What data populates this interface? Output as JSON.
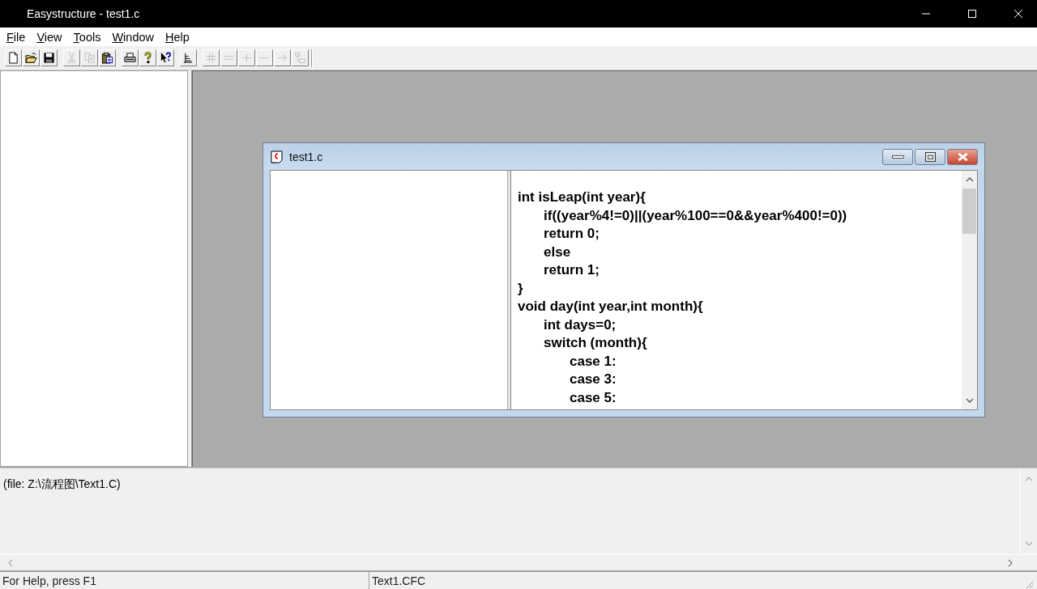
{
  "window": {
    "title": "Easystructure - test1.c"
  },
  "menu": [
    {
      "label": "File"
    },
    {
      "label": "View"
    },
    {
      "label": "Tools"
    },
    {
      "label": "Window"
    },
    {
      "label": "Help"
    }
  ],
  "toolbar": [
    {
      "buttons": [
        {
          "kind": "new",
          "disabled": false
        },
        {
          "kind": "open",
          "disabled": false
        },
        {
          "kind": "save",
          "disabled": false
        }
      ]
    },
    {
      "buttons": [
        {
          "kind": "cut",
          "disabled": true
        },
        {
          "kind": "copy",
          "disabled": true
        },
        {
          "kind": "paste",
          "disabled": false
        }
      ]
    },
    {
      "buttons": [
        {
          "kind": "print",
          "disabled": false
        },
        {
          "kind": "help",
          "disabled": false
        },
        {
          "kind": "context-help",
          "disabled": false
        }
      ]
    },
    {
      "buttons": [
        {
          "kind": "tree",
          "disabled": false
        }
      ]
    },
    {
      "buttons": [
        {
          "kind": "hash",
          "disabled": true
        },
        {
          "kind": "equals",
          "disabled": true
        },
        {
          "kind": "plus",
          "disabled": true
        },
        {
          "kind": "minus",
          "disabled": true
        },
        {
          "kind": "arrow",
          "disabled": true
        },
        {
          "kind": "flow",
          "disabled": true
        }
      ]
    }
  ],
  "child_window": {
    "title": "test1.c",
    "code": [
      {
        "text": "int isLeap(int year){",
        "children": [
          {
            "text": "if((year%4!=0)||(year%100==0&&year%400!=0))"
          },
          {
            "text": "return 0;"
          },
          {
            "text": "else"
          },
          {
            "text": "return 1;"
          }
        ]
      },
      {
        "text": "}"
      },
      {
        "text": "void day(int year,int month){",
        "children": [
          {
            "text": "int days=0;"
          },
          {
            "text": "switch (month){",
            "children": [
              {
                "text": "case 1:"
              },
              {
                "text": "case 3:"
              },
              {
                "text": "case 5:"
              }
            ]
          }
        ]
      }
    ]
  },
  "output": {
    "text": "(file: Z:\\流程图\\Text1.C)"
  },
  "status_bar": [
    "For Help, press F1",
    "Text1.CFC"
  ]
}
